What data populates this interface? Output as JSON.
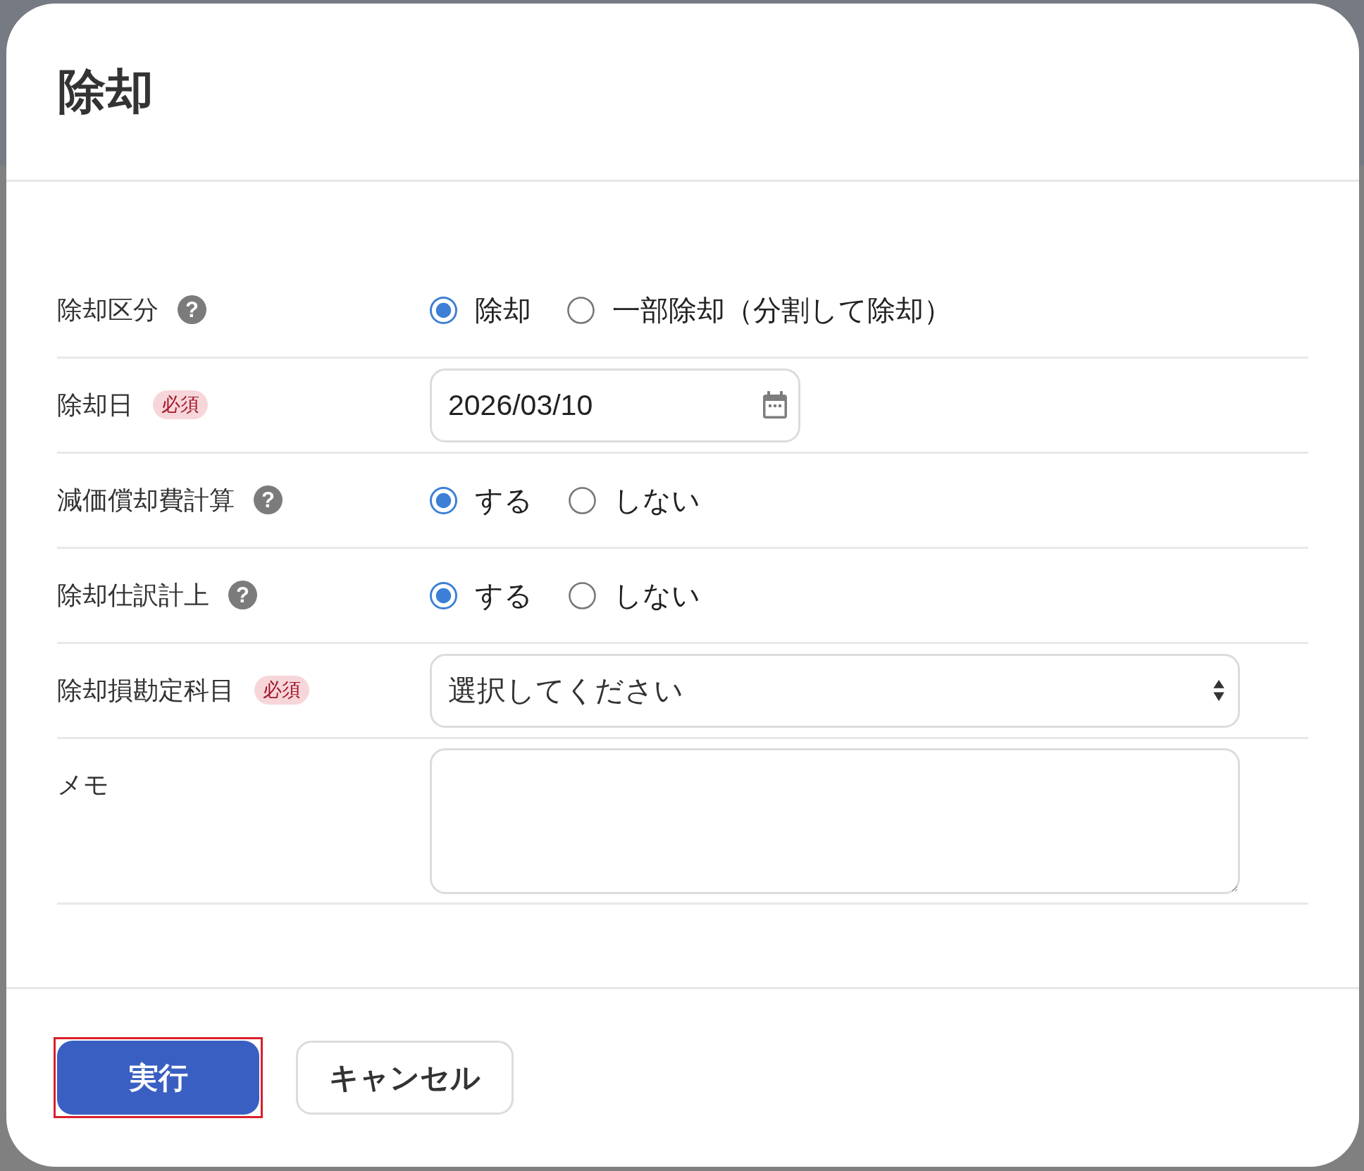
{
  "dialog": {
    "title": "除却"
  },
  "fields": [
    {
      "kind": "radio",
      "label": "除却区分",
      "help": "?",
      "options": [
        {
          "label": "除却",
          "selected": true
        },
        {
          "label": "一部除却（分割して除却）",
          "selected": false
        }
      ]
    },
    {
      "kind": "date",
      "label": "除却日",
      "required_badge": "必須",
      "value": "2026/03/10"
    },
    {
      "kind": "radio",
      "label": "減価償却費計算",
      "help": "?",
      "options": [
        {
          "label": "する",
          "selected": true
        },
        {
          "label": "しない",
          "selected": false
        }
      ]
    },
    {
      "kind": "radio",
      "label": "除却仕訳計上",
      "help": "?",
      "options": [
        {
          "label": "する",
          "selected": true
        },
        {
          "label": "しない",
          "selected": false
        }
      ]
    },
    {
      "kind": "select",
      "label": "除却損勘定科目",
      "required_badge": "必須",
      "value": "選択してください"
    },
    {
      "kind": "textarea",
      "label": "メモ"
    }
  ],
  "buttons": [
    {
      "label": "実行",
      "kind": "primary",
      "focused": true
    },
    {
      "label": "キャンセル",
      "kind": "secondary",
      "focused": false
    }
  ]
}
